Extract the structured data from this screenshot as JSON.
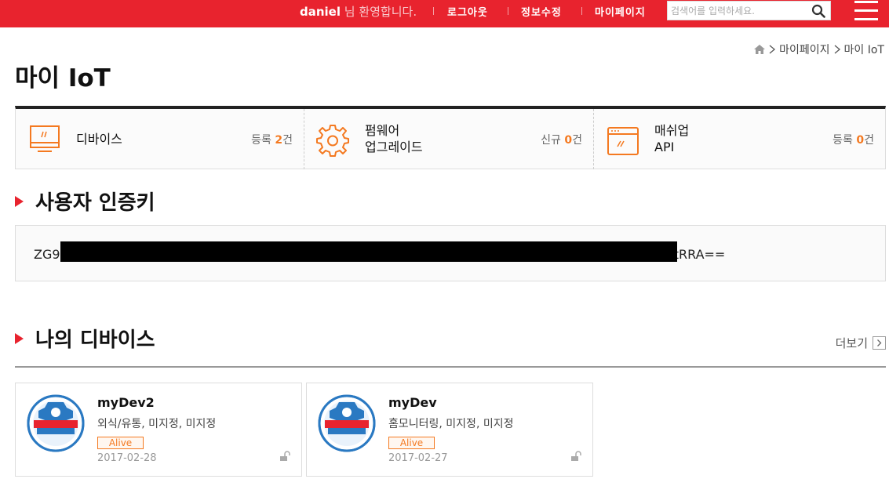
{
  "header": {
    "user_name": "daniel",
    "welcome_suffix": " 님 환영합니다.",
    "links": [
      "로그아웃",
      "정보수정",
      "마이페이지"
    ],
    "search_placeholder": "검색어를 입력하세요.",
    "accent_color": "#e8232e"
  },
  "breadcrumb": {
    "home_icon": "home-icon",
    "items": [
      "마이페이지",
      "마이 IoT"
    ]
  },
  "page": {
    "title": "마이 IoT"
  },
  "summary": [
    {
      "label_line1": "디바이스",
      "label_line2": "",
      "count_prefix": "등록 ",
      "count": "2",
      "count_suffix": "건",
      "icon": "monitor-icon"
    },
    {
      "label_line1": "펌웨어",
      "label_line2": "업그레이드",
      "count_prefix": "신규 ",
      "count": "0",
      "count_suffix": "건",
      "icon": "gear-icon"
    },
    {
      "label_line1": "매쉬업",
      "label_line2": "API",
      "count_prefix": "등록 ",
      "count": "0",
      "count_suffix": "건",
      "icon": "browser-window-icon"
    }
  ],
  "auth_key": {
    "title": "사용자 인증키",
    "key_start": "ZG9",
    "key_end": "StRRA=="
  },
  "devices": {
    "title": "나의 디바이스",
    "more_label": "더보기",
    "items": [
      {
        "name": "myDev2",
        "desc": "외식/유통, 미지정, 미지정",
        "status": "Alive",
        "date": "2017-02-28",
        "logo": "wiznet-maker-space-academy-logo"
      },
      {
        "name": "myDev",
        "desc": "홈모니터링, 미지정, 미지정",
        "status": "Alive",
        "date": "2017-02-27",
        "logo": "wiznet-maker-space-academy-logo"
      }
    ]
  }
}
